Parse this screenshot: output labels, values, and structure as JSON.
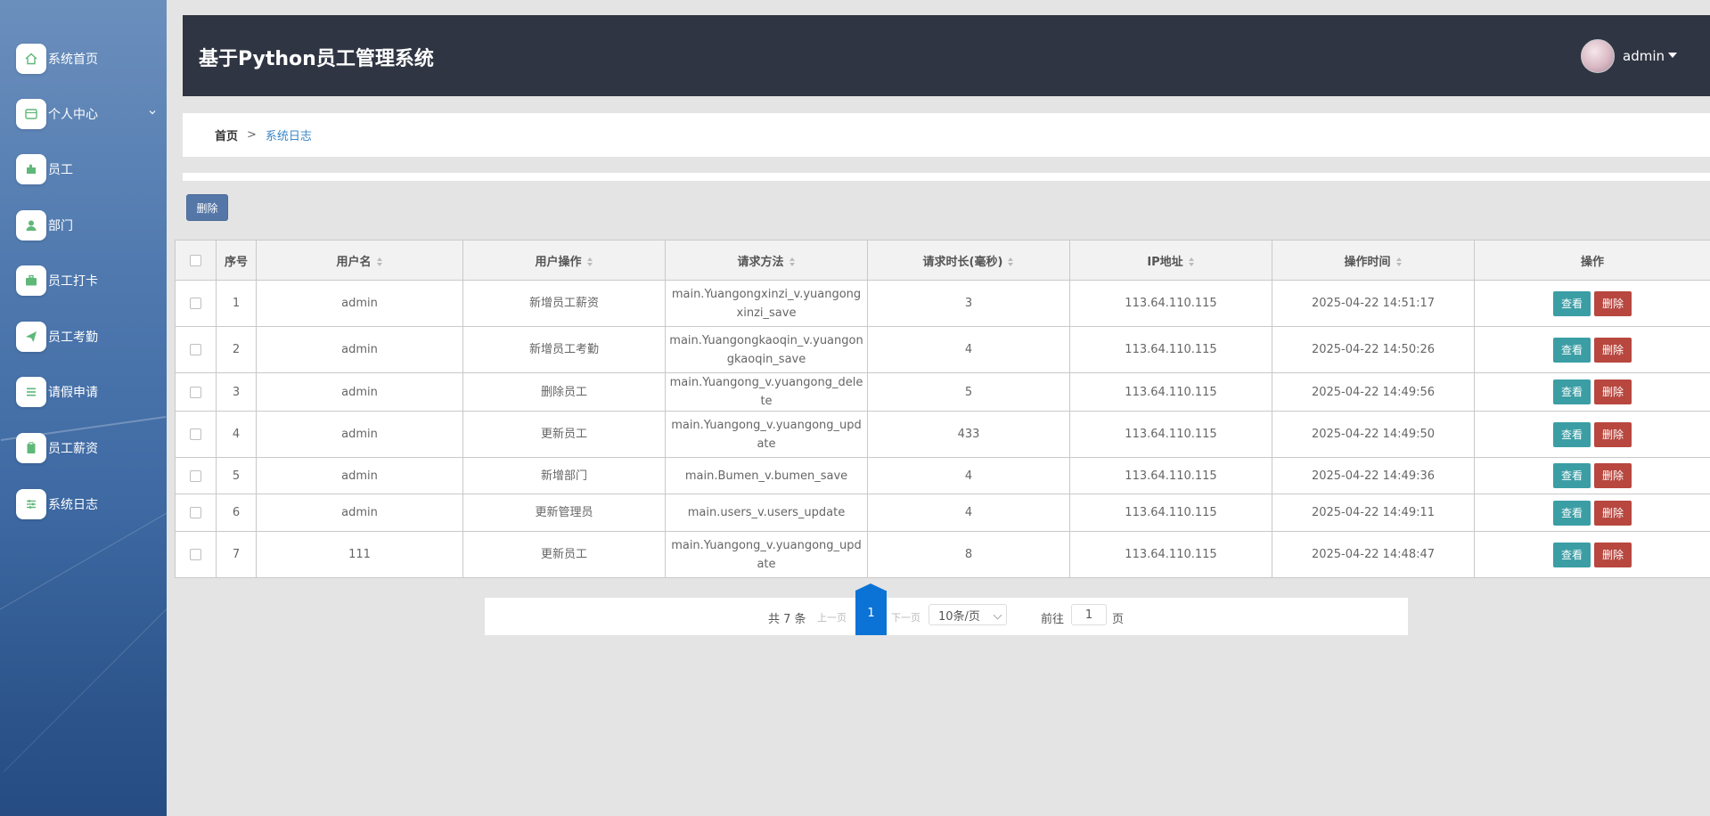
{
  "sidebar": {
    "items": [
      {
        "label": "系统首页",
        "icon": "home-icon"
      },
      {
        "label": "个人中心",
        "icon": "id-card-icon",
        "has_children": true
      },
      {
        "label": "员工",
        "icon": "puzzle-icon"
      },
      {
        "label": "部门",
        "icon": "user-icon"
      },
      {
        "label": "员工打卡",
        "icon": "briefcase-icon"
      },
      {
        "label": "员工考勤",
        "icon": "paper-plane-icon"
      },
      {
        "label": "请假申请",
        "icon": "list-icon"
      },
      {
        "label": "员工薪资",
        "icon": "clipboard-icon"
      },
      {
        "label": "系统日志",
        "icon": "sliders-icon"
      }
    ]
  },
  "header": {
    "title": "基于Python员工管理系统",
    "username": "admin"
  },
  "breadcrumb": {
    "home": "首页",
    "separator": ">",
    "current": "系统日志"
  },
  "toolbar": {
    "delete_label": "删除"
  },
  "table": {
    "headers": {
      "index": "序号",
      "username": "用户名",
      "operation": "用户操作",
      "method": "请求方法",
      "duration": "请求时长(毫秒)",
      "ip": "IP地址",
      "time": "操作时间",
      "actions": "操作"
    },
    "view_label": "查看",
    "delete_label": "删除",
    "rows": [
      {
        "index": "1",
        "username": "admin",
        "operation": "新增员工薪资",
        "method": "main.Yuangongxinzi_v.yuangongxinzi_save",
        "duration": "3",
        "ip": "113.64.110.115",
        "time": "2025-04-22 14:51:17"
      },
      {
        "index": "2",
        "username": "admin",
        "operation": "新增员工考勤",
        "method": "main.Yuangongkaoqin_v.yuangongkaoqin_save",
        "duration": "4",
        "ip": "113.64.110.115",
        "time": "2025-04-22 14:50:26"
      },
      {
        "index": "3",
        "username": "admin",
        "operation": "删除员工",
        "method": "main.Yuangong_v.yuangong_delete",
        "duration": "5",
        "ip": "113.64.110.115",
        "time": "2025-04-22 14:49:56"
      },
      {
        "index": "4",
        "username": "admin",
        "operation": "更新员工",
        "method": "main.Yuangong_v.yuangong_update",
        "duration": "433",
        "ip": "113.64.110.115",
        "time": "2025-04-22 14:49:50"
      },
      {
        "index": "5",
        "username": "admin",
        "operation": "新增部门",
        "method": "main.Bumen_v.bumen_save",
        "duration": "4",
        "ip": "113.64.110.115",
        "time": "2025-04-22 14:49:36"
      },
      {
        "index": "6",
        "username": "admin",
        "operation": "更新管理员",
        "method": "main.users_v.users_update",
        "duration": "4",
        "ip": "113.64.110.115",
        "time": "2025-04-22 14:49:11"
      },
      {
        "index": "7",
        "username": "111",
        "operation": "更新员工",
        "method": "main.Yuangong_v.yuangong_update",
        "duration": "8",
        "ip": "113.64.110.115",
        "time": "2025-04-22 14:48:47"
      }
    ]
  },
  "pagination": {
    "total": "共 7 条",
    "prev": "上一页",
    "current_page": "1",
    "next": "下一页",
    "page_size": "10条/页",
    "goto_prefix": "前往",
    "goto_value": "1",
    "goto_suffix": "页"
  },
  "colors": {
    "header_bg": "#2f3542",
    "view_button": "#3b9ea5",
    "delete_button": "#b8473f",
    "pager_active": "#0b73d6",
    "toolbar_delete": "#5577a8"
  }
}
